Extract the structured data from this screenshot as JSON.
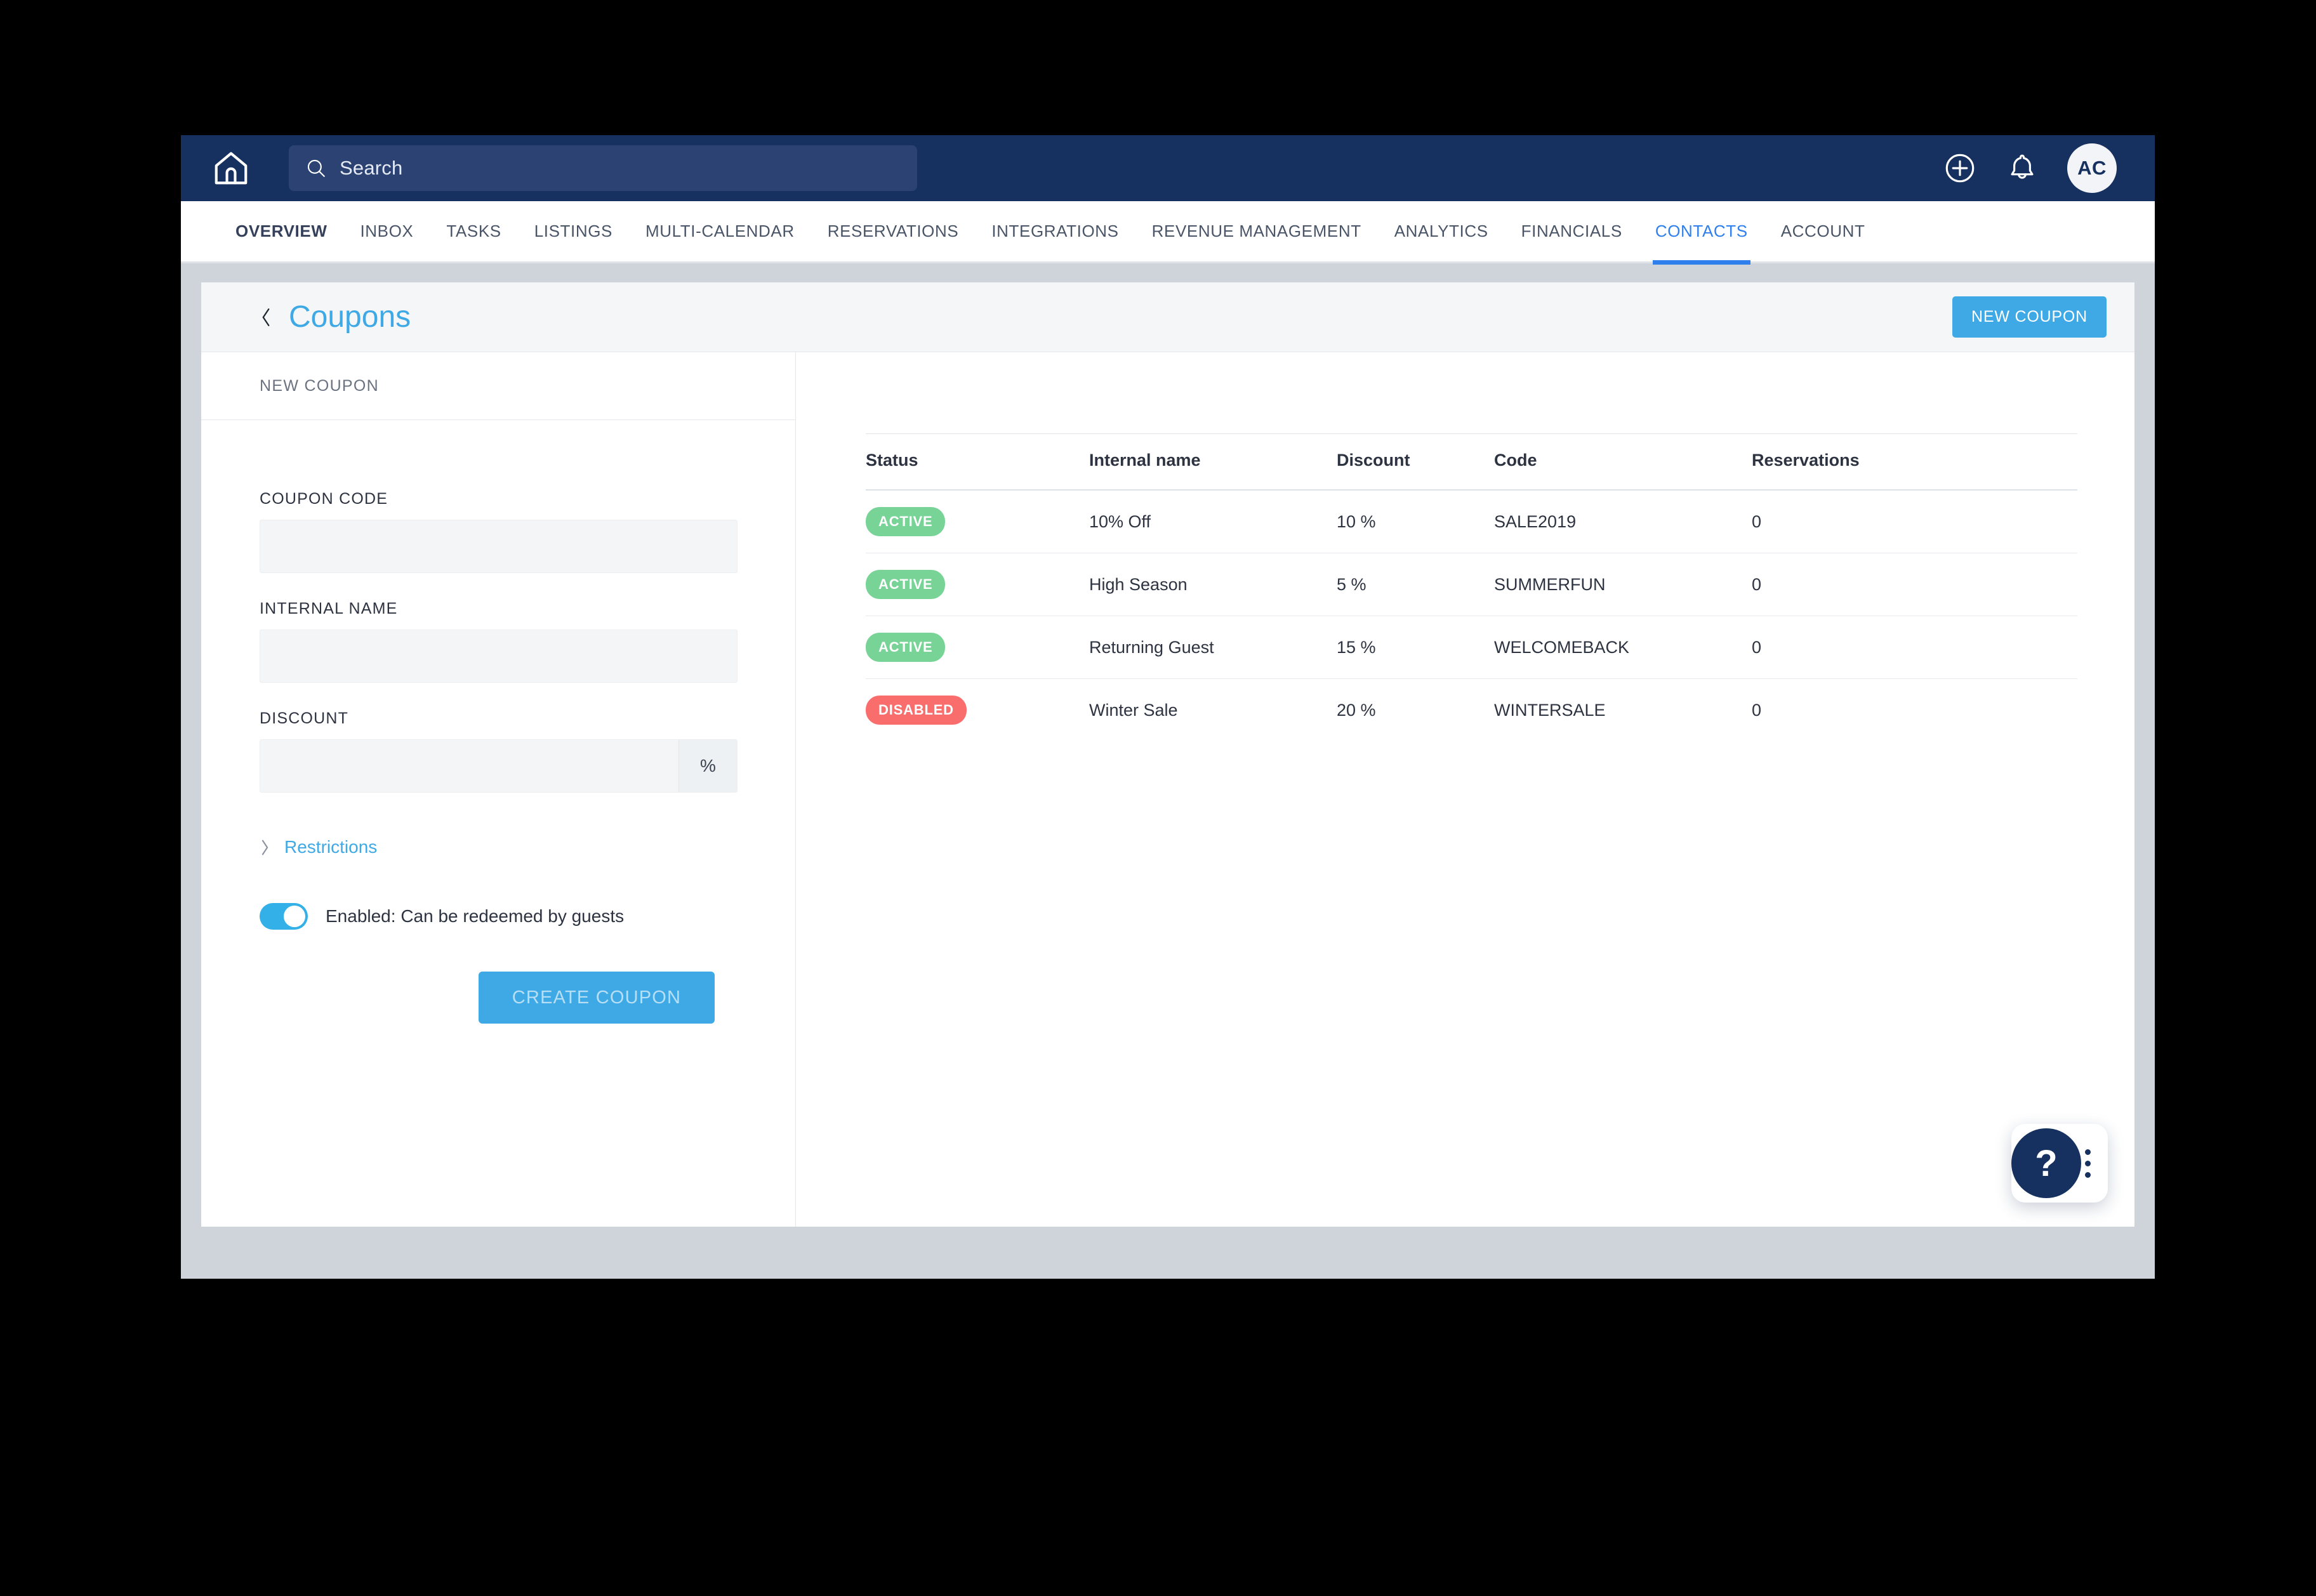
{
  "topbar": {
    "home_icon": "home-icon",
    "search": {
      "icon": "search-icon",
      "placeholder": "Search",
      "value": ""
    },
    "add_icon": "plus-circle-icon",
    "notifications_icon": "bell-icon",
    "avatar_initials": "AC"
  },
  "nav": {
    "items": [
      {
        "label": "OVERVIEW",
        "bold": true,
        "active": false
      },
      {
        "label": "INBOX",
        "bold": false,
        "active": false
      },
      {
        "label": "TASKS",
        "bold": false,
        "active": false
      },
      {
        "label": "LISTINGS",
        "bold": false,
        "active": false
      },
      {
        "label": "MULTI-CALENDAR",
        "bold": false,
        "active": false
      },
      {
        "label": "RESERVATIONS",
        "bold": false,
        "active": false
      },
      {
        "label": "INTEGRATIONS",
        "bold": false,
        "active": false
      },
      {
        "label": "REVENUE MANAGEMENT",
        "bold": false,
        "active": false
      },
      {
        "label": "ANALYTICS",
        "bold": false,
        "active": false
      },
      {
        "label": "FINANCIALS",
        "bold": false,
        "active": false
      },
      {
        "label": "CONTACTS",
        "bold": false,
        "active": true
      },
      {
        "label": "ACCOUNT",
        "bold": false,
        "active": false
      }
    ]
  },
  "page": {
    "back_icon": "chevron-left-icon",
    "title": "Coupons",
    "new_coupon_label": "NEW COUPON"
  },
  "form": {
    "section_title": "NEW COUPON",
    "coupon_code": {
      "label": "COUPON CODE",
      "value": "",
      "placeholder": ""
    },
    "internal_name": {
      "label": "INTERNAL NAME",
      "value": "",
      "placeholder": ""
    },
    "discount": {
      "label": "DISCOUNT",
      "value": "",
      "placeholder": "",
      "suffix": "%"
    },
    "restrictions": {
      "label": "Restrictions",
      "icon": "chevron-right-icon",
      "expanded": false
    },
    "toggle": {
      "label": "Enabled: Can be redeemed by guests",
      "on": true
    },
    "submit_label": "CREATE COUPON",
    "submit_disabled": true
  },
  "table": {
    "columns": [
      "Status",
      "Internal name",
      "Discount",
      "Code",
      "Reservations"
    ],
    "rows": [
      {
        "status": "ACTIVE",
        "status_kind": "active",
        "name": "10% Off",
        "discount": "10 %",
        "code": "SALE2019",
        "reservations": "0"
      },
      {
        "status": "ACTIVE",
        "status_kind": "active",
        "name": "High Season",
        "discount": "5 %",
        "code": "SUMMERFUN",
        "reservations": "0"
      },
      {
        "status": "ACTIVE",
        "status_kind": "active",
        "name": "Returning Guest",
        "discount": "15 %",
        "code": "WELCOMEBACK",
        "reservations": "0"
      },
      {
        "status": "DISABLED",
        "status_kind": "disabled",
        "name": "Winter Sale",
        "discount": "20 %",
        "code": "WINTERSALE",
        "reservations": "0"
      }
    ]
  },
  "help": {
    "icon": "question-mark-icon",
    "label": "?",
    "menu_icon": "more-vertical-icon"
  },
  "colors": {
    "navbar": "#16305f",
    "accent": "#3fa9e5",
    "active_tab": "#2f80ed",
    "badge_active": "#78d396",
    "badge_disabled": "#fa6d6d"
  }
}
